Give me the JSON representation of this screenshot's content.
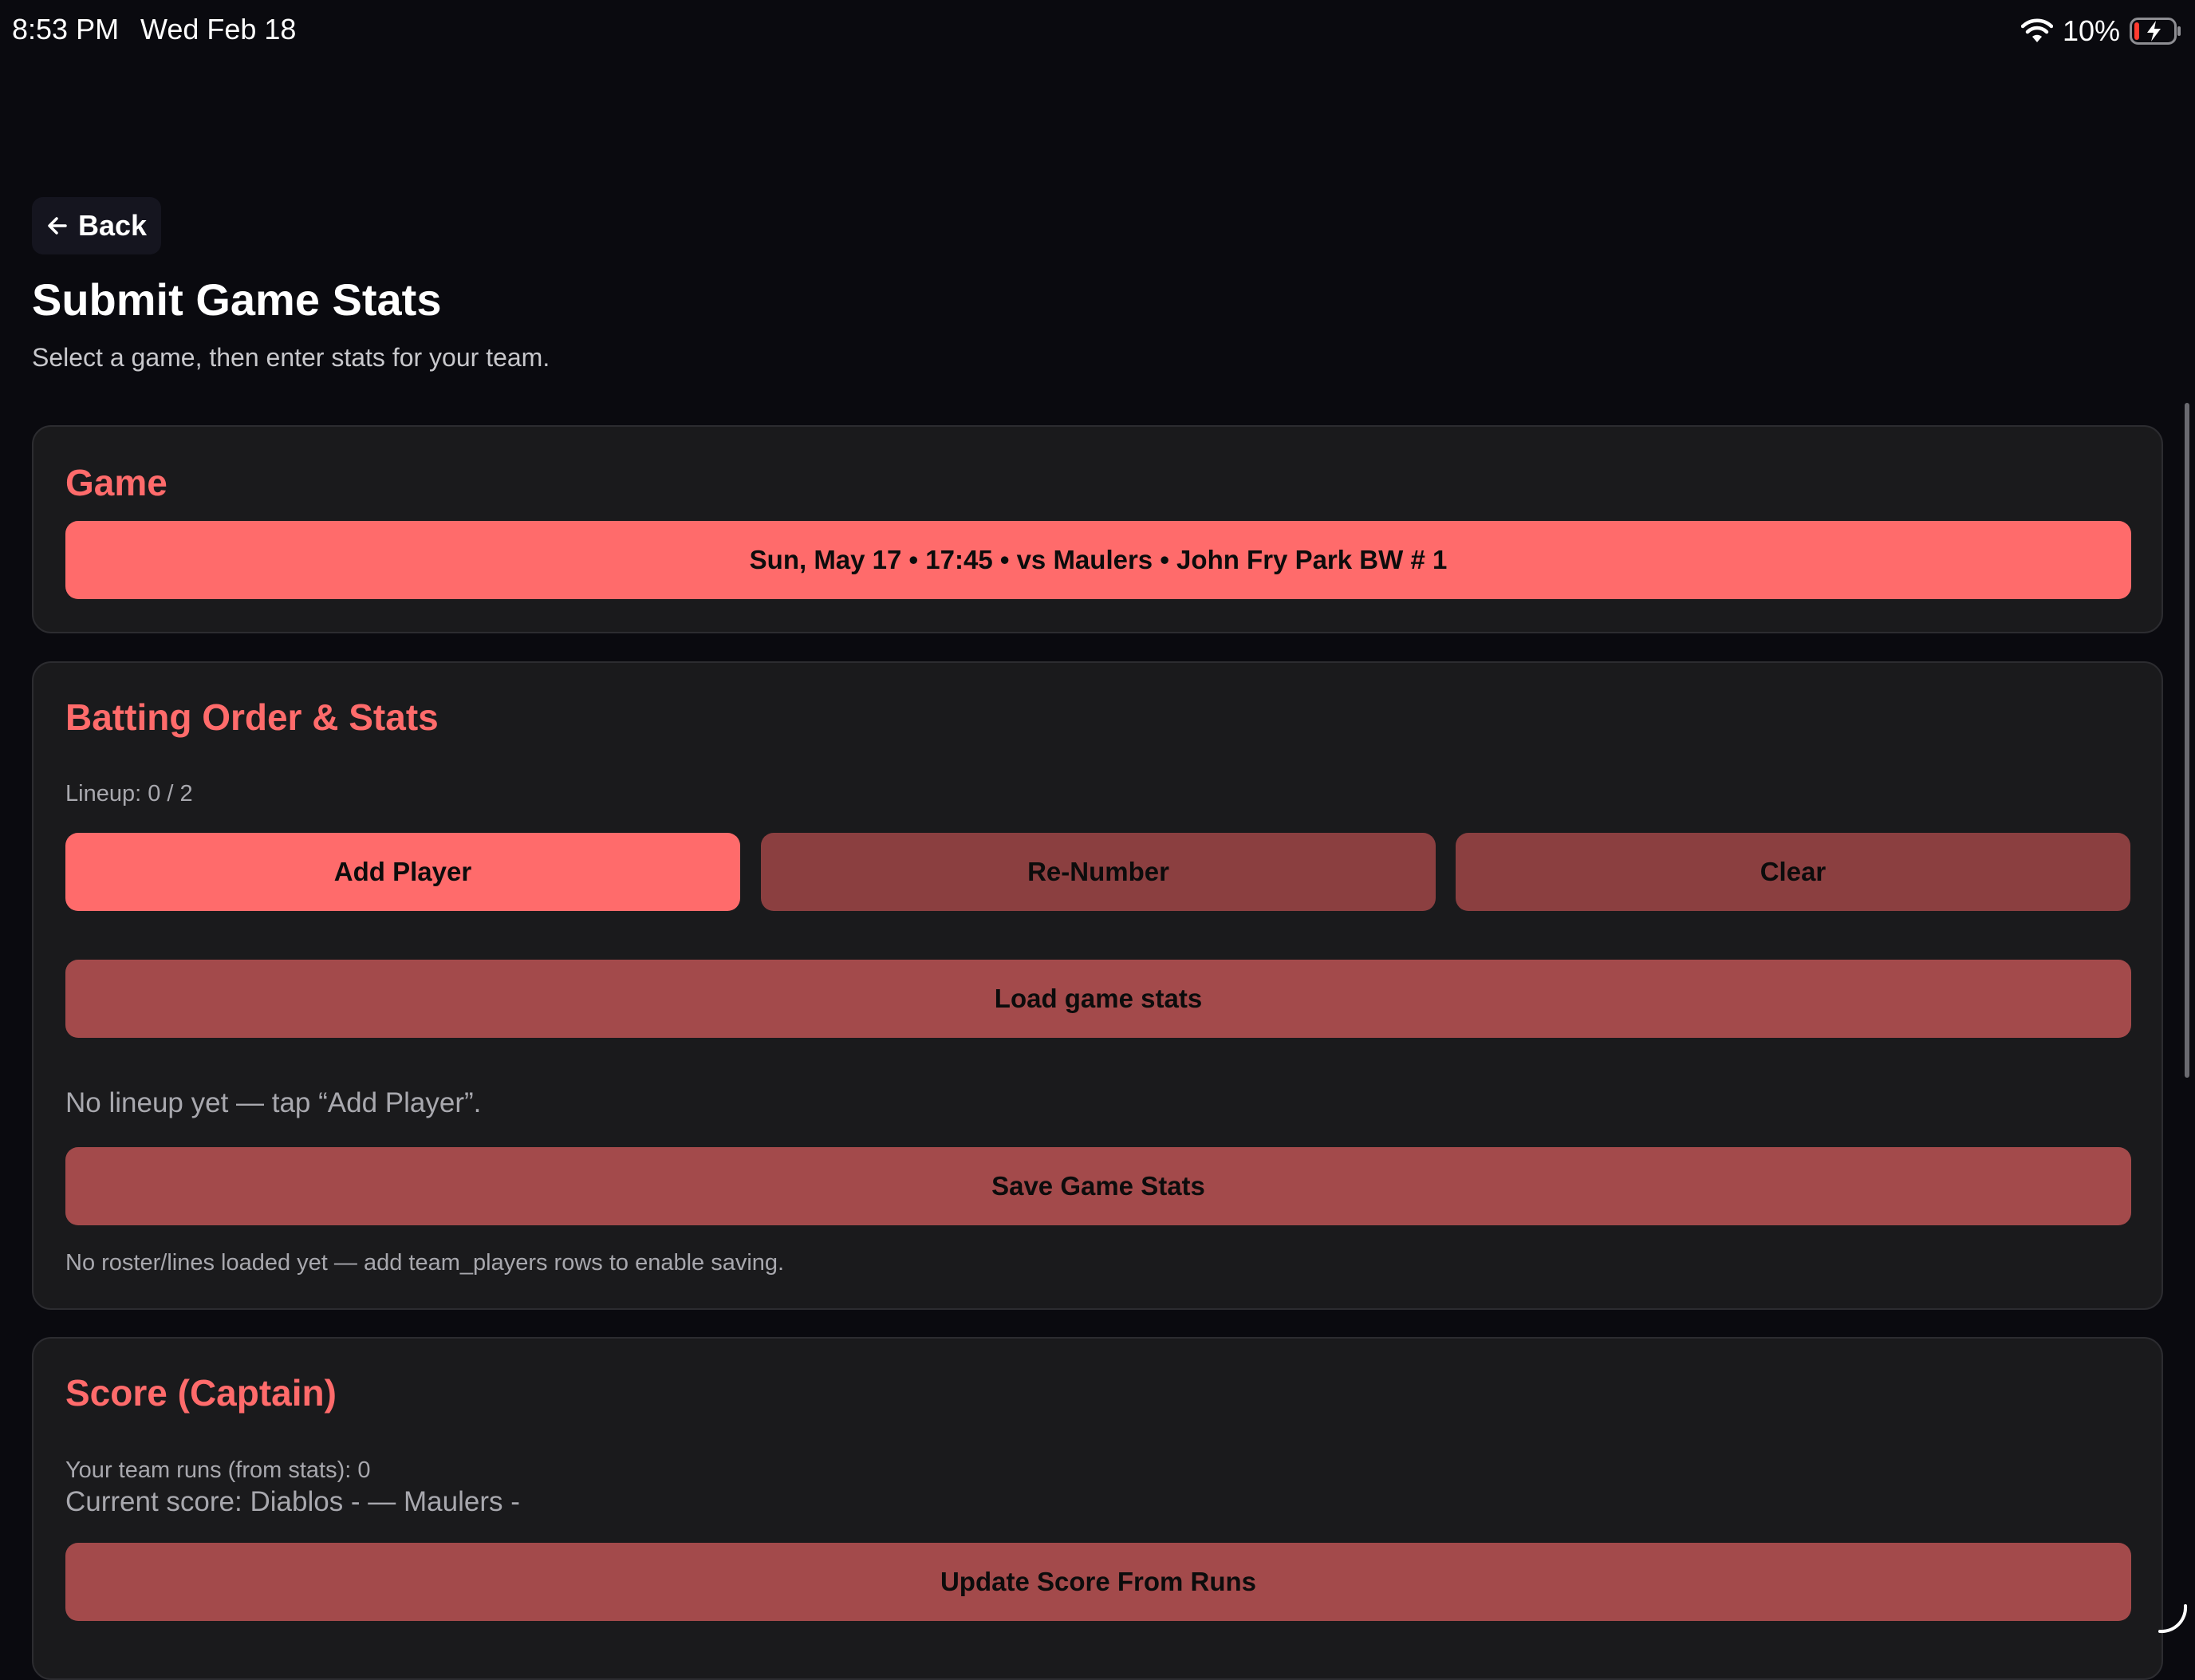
{
  "status_bar": {
    "time": "8:53 PM",
    "date": "Wed Feb 18",
    "battery_percent": "10%",
    "icons": [
      "wifi-icon",
      "battery-charging-icon"
    ]
  },
  "back_button": {
    "label": "Back",
    "icon": "arrow-left-icon"
  },
  "page": {
    "title": "Submit Game Stats",
    "subtitle": "Select a game, then enter stats for your team."
  },
  "game_card": {
    "title": "Game",
    "selected_game": "Sun, May 17 • 17:45 • vs Maulers • John Fry Park BW # 1"
  },
  "batting_card": {
    "title": "Batting Order & Stats",
    "lineup_count": "Lineup: 0 / 2",
    "add_player_label": "Add Player",
    "renumber_label": "Re-Number",
    "clear_label": "Clear",
    "load_stats_label": "Load game stats",
    "empty_message": "No lineup yet — tap “Add Player”.",
    "save_label": "Save Game Stats",
    "roster_note": "No roster/lines loaded yet — add team_players rows to enable saving."
  },
  "score_card": {
    "title": "Score (Captain)",
    "team_runs": "Your team runs (from stats): 0",
    "current_score": "Current score: Diablos - — Maulers -",
    "update_label": "Update Score From Runs"
  },
  "colors": {
    "background": "#0a0a0f",
    "card": "#1a1a1c",
    "accent": "#ff6b6b",
    "button_muted": "#8b3f40",
    "button_mid": "#a34a4b"
  }
}
